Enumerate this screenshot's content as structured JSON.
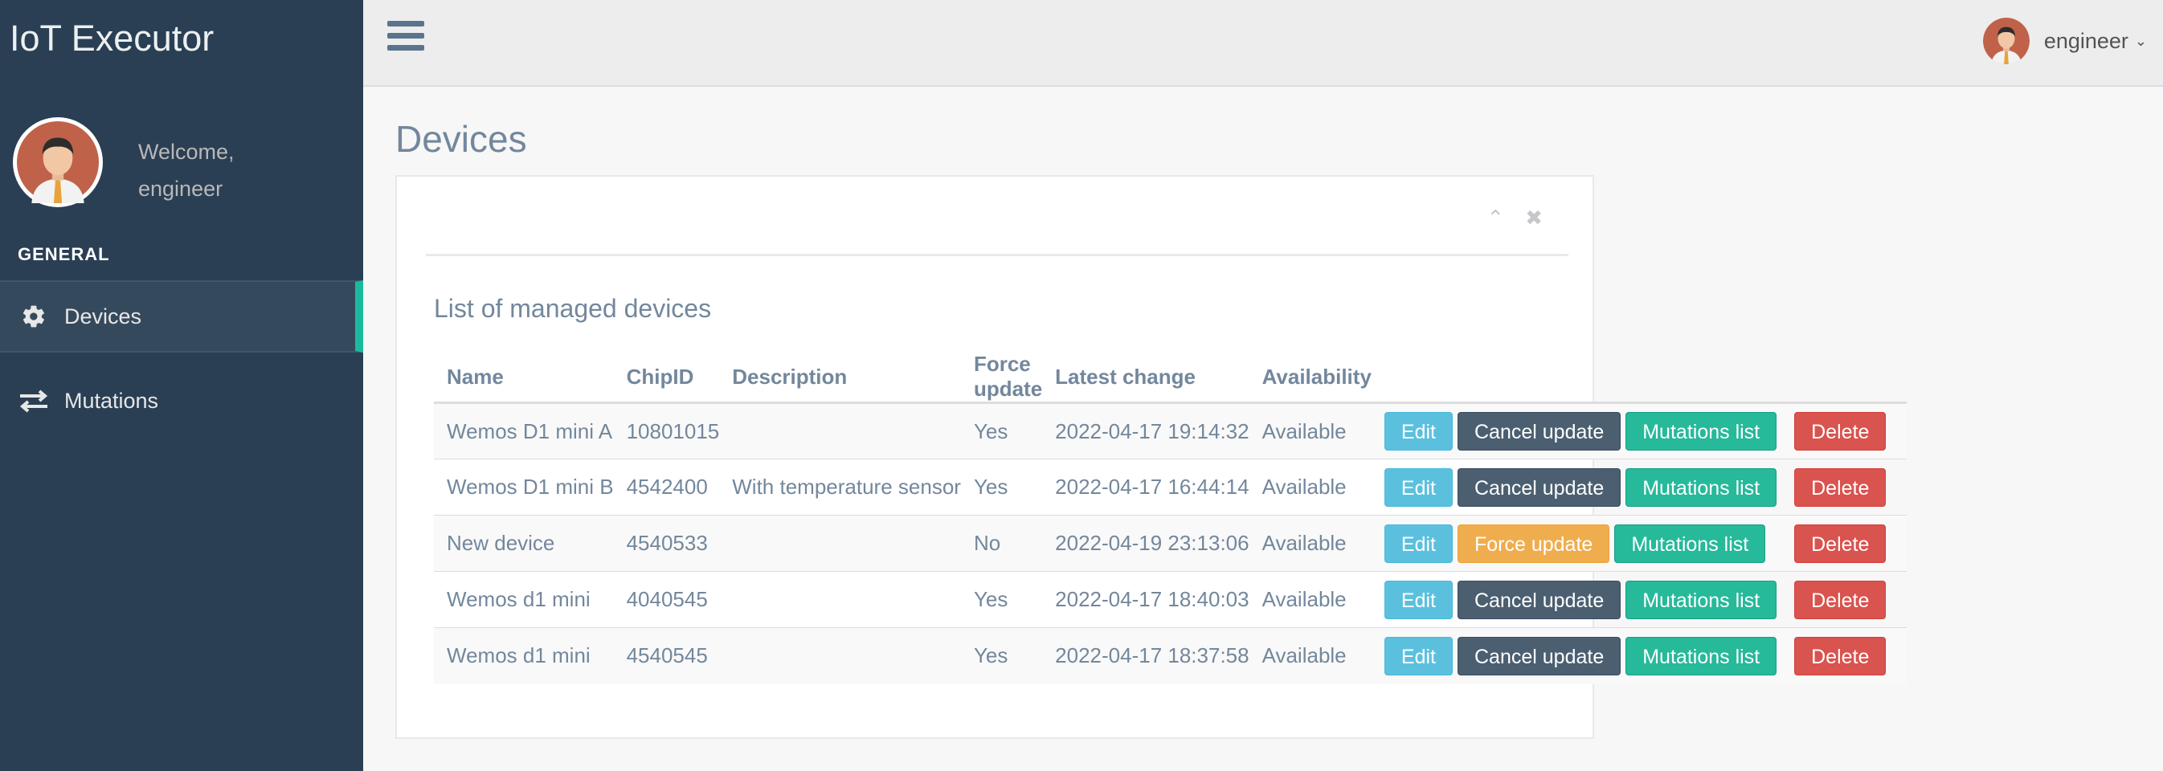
{
  "app": {
    "title": "IoT Executor"
  },
  "sidebar": {
    "welcome": "Welcome,",
    "username": "engineer",
    "section": "GENERAL",
    "items": [
      {
        "label": "Devices",
        "icon": "gear-icon",
        "active": true
      },
      {
        "label": "Mutations",
        "icon": "exchange-icon",
        "active": false
      }
    ]
  },
  "topbar": {
    "username": "engineer"
  },
  "page": {
    "title": "Devices",
    "panel_title": "List of managed devices"
  },
  "table": {
    "headers": [
      "Name",
      "ChipID",
      "Description",
      "Force update",
      "Latest change",
      "Availability"
    ],
    "rows": [
      {
        "name": "Wemos D1 mini A",
        "chipid": "10801015",
        "description": "",
        "force_update": "Yes",
        "latest_change": "2022-04-17 19:14:32",
        "availability": "Available",
        "edit": "Edit",
        "action": "Cancel update",
        "action_style": "dark",
        "mutations": "Mutations list",
        "delete": "Delete"
      },
      {
        "name": "Wemos D1 mini B",
        "chipid": "4542400",
        "description": "With temperature sensor",
        "force_update": "Yes",
        "latest_change": "2022-04-17 16:44:14",
        "availability": "Available",
        "edit": "Edit",
        "action": "Cancel update",
        "action_style": "dark",
        "mutations": "Mutations list",
        "delete": "Delete"
      },
      {
        "name": "New device",
        "chipid": "4540533",
        "description": "",
        "force_update": "No",
        "latest_change": "2022-04-19 23:13:06",
        "availability": "Available",
        "edit": "Edit",
        "action": "Force update",
        "action_style": "warning",
        "mutations": "Mutations list",
        "delete": "Delete"
      },
      {
        "name": "Wemos d1 mini",
        "chipid": "4040545",
        "description": "",
        "force_update": "Yes",
        "latest_change": "2022-04-17 18:40:03",
        "availability": "Available",
        "edit": "Edit",
        "action": "Cancel update",
        "action_style": "dark",
        "mutations": "Mutations list",
        "delete": "Delete"
      },
      {
        "name": "Wemos d1 mini",
        "chipid": "4540545",
        "description": "",
        "force_update": "Yes",
        "latest_change": "2022-04-17 18:37:58",
        "availability": "Available",
        "edit": "Edit",
        "action": "Cancel update",
        "action_style": "dark",
        "mutations": "Mutations list",
        "delete": "Delete"
      }
    ]
  },
  "colors": {
    "sidebar": "#2A3F54",
    "accent": "#1ABB9C"
  }
}
